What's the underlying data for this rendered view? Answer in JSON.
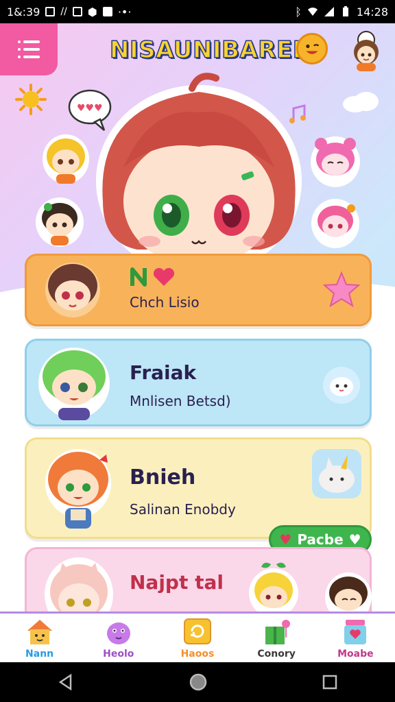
{
  "status_bar": {
    "time_left": "1&:39",
    "time_right": "14:28",
    "icons_left": [
      "signal-text-icon",
      "signal-icon",
      "box-icon",
      "shield-icon",
      "image-icon",
      "more-dots-icon"
    ],
    "icons_right": [
      "bluetooth-icon",
      "wifi-icon",
      "cell-signal-icon",
      "battery-icon"
    ]
  },
  "header": {
    "title": "NISAUNIBAREI"
  },
  "cards": [
    {
      "title": "",
      "subtitle": "Chch Lisio",
      "color": "#f8b35a"
    },
    {
      "title": "Fraiak",
      "subtitle": "Mnlisen Betsd)",
      "color": "#bde6f7"
    },
    {
      "title": "Bnieh",
      "subtitle": "Salinan Enobdy",
      "color": "#fbf0bd",
      "button_label": "Pacbe"
    },
    {
      "title": "Najpt tal",
      "subtitle": "",
      "color": "#fbd7ea"
    }
  ],
  "bottom_nav": [
    {
      "label": "Nann",
      "color": "#2a9be0",
      "icon": "house-icon"
    },
    {
      "label": "Heolo",
      "color": "#9d4fc7",
      "icon": "creature-icon"
    },
    {
      "label": "Haoos",
      "color": "#f3902a",
      "icon": "refresh-icon"
    },
    {
      "label": "Conory",
      "color": "#3a3a3a",
      "icon": "gift-icon"
    },
    {
      "label": "Moabe",
      "color": "#c0398a",
      "icon": "jar-icon"
    }
  ],
  "colors": {
    "accent_pink": "#f25aa2",
    "title_yellow": "#f7d330",
    "title_outline": "#2a3a86",
    "nav_border": "#b48ae3"
  }
}
